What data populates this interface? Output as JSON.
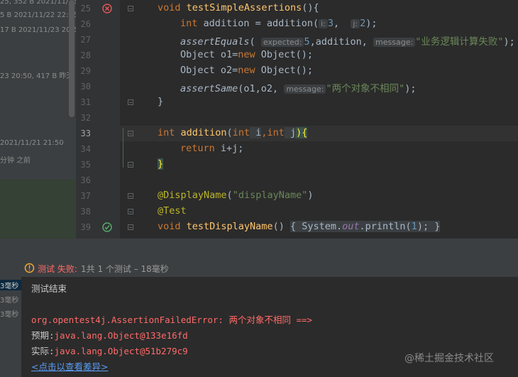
{
  "left_panel": {
    "items": [
      {
        "text": "25, 352 B 2021/11/23 19:16"
      },
      {
        "text": "5 B 2021/11/22 22:26"
      },
      {
        "text": "17 B 2021/11/23 20:5"
      },
      {
        "text": "23 20:50, 417 B 昨天"
      },
      {
        "text": "2021/11/21 21:50"
      },
      {
        "text": "分钟 之前"
      }
    ]
  },
  "editor": {
    "line_numbers": [
      "25",
      "26",
      "27",
      "28",
      "29",
      "30",
      "31",
      "32",
      "33",
      "34",
      "35",
      "36",
      "37",
      "38",
      "39"
    ],
    "line25": {
      "kw": "void",
      "name": "testSimpleAssertions",
      "rest": "(){"
    },
    "line26": {
      "kw": "int",
      "var": " addition = addition(",
      "hint_i": "i:",
      "v1": "3",
      "sep": ",  ",
      "hint_j": "j:",
      "v2": "2",
      "end": ");"
    },
    "line27": {
      "fn": "assertEquals",
      "open": "(",
      "hint_expected": "expected:",
      "v1": "5",
      "mid": ",addition, ",
      "hint_message": "message:",
      "msg": "\"业务逻辑计算失败\"",
      "end": ");"
    },
    "line28": {
      "a": "Object o1=",
      "kw": "new",
      "b": " Object();"
    },
    "line29": {
      "a": "Object o2=",
      "kw": "new",
      "b": " Object();"
    },
    "line30": {
      "fn": "assertSame",
      "mid": "(o1,o2, ",
      "hint_message": "message:",
      "msg": "\"两个对象不相同\"",
      "end": ");"
    },
    "line31": {
      "text": "}"
    },
    "line33": {
      "kw1": "int",
      "fn": " addition",
      "p1": "(",
      "kw2": "int",
      "i": " i",
      "c": ",",
      "kw3": "int",
      "j": " j",
      "close": "){"
    },
    "line34": {
      "kw": "return",
      "rest": " i+j;"
    },
    "line35": {
      "text": "}"
    },
    "line37": {
      "ann": "@DisplayName",
      "p": "(",
      "str": "\"displayName\"",
      "c": ")"
    },
    "line38": {
      "ann": "@Test"
    },
    "line39": {
      "kw": "void",
      "fn": " testDisplayName",
      "p": "() ",
      "b1": "{",
      "sys": " System.",
      "out": "out",
      "pl": ".println(",
      "num": "1",
      "e": "); ",
      "b2": "}"
    }
  },
  "status": {
    "prefix": "测试 失败:",
    "count": "1共 1 个测试 – 18毫秒"
  },
  "console_left": {
    "items": [
      "3毫秒",
      "3毫秒",
      "3毫秒"
    ]
  },
  "console": {
    "line1": "测试结束",
    "error_class": "org.opentest4j.AssertionFailedError:",
    "error_msg": " 两个对象不相同 ==>",
    "expected_label": "预期:",
    "expected_val": "java.lang.Object@133e16fd",
    "actual_label": "实际:",
    "actual_val": "java.lang.Object@51b279c9",
    "diff_link": "<点击以查看差异>",
    "watermark": "@稀土掘金技术社区"
  },
  "colors": {
    "keyword": "#cc7832",
    "function": "#ffc66d",
    "string": "#6a8759",
    "error_red": "#ff6b68",
    "link_blue": "#589df6"
  }
}
